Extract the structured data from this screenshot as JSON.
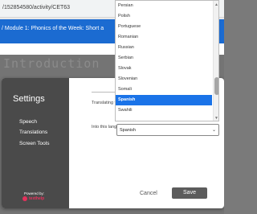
{
  "browser": {
    "url": "/152854580/activity/CET63"
  },
  "course": {
    "title": "/ Module 1: Phonics of the Week: Short a"
  },
  "background": {
    "heading": "Introduction"
  },
  "settings": {
    "title": "Settings",
    "nav": [
      "Speech",
      "Translations",
      "Screen Tools"
    ],
    "active_nav": "Translations",
    "translating_from_label": "Translating from:",
    "into_language_label": "Into this language:",
    "selected_language": "Spanish",
    "cancel_label": "Cancel",
    "save_label": "Save",
    "powered_by": "Powered by:",
    "brand": "texthelp"
  },
  "dropdown": {
    "options": [
      "Persian",
      "Polish",
      "Portuguese",
      "Romanian",
      "Russian",
      "Serbian",
      "Slovak",
      "Slovenian",
      "Somali",
      "Spanish",
      "Swahili"
    ],
    "highlighted": "Spanish"
  },
  "colors": {
    "accent": "#1a73e8",
    "course_bar": "#1b6bd1",
    "modal_side": "#4a4a4a",
    "save_button": "#5c5c5c"
  }
}
